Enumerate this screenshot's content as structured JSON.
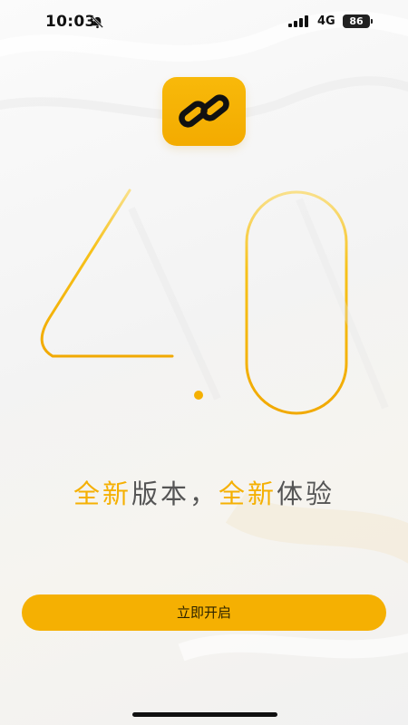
{
  "status_bar": {
    "time": "10:03",
    "network": "4G",
    "battery": "86",
    "icons": [
      "bell-off-icon",
      "signal-icon",
      "battery-icon"
    ]
  },
  "app": {
    "logo_icon": "chain-link-icon",
    "accent_color": "#F5B002"
  },
  "hero": {
    "version": "4.0"
  },
  "slogan": {
    "part1_accent": "全新",
    "part1_rest": "版本，",
    "part2_accent": "全新",
    "part2_rest": "体验"
  },
  "actions": {
    "start_label": "立即开启"
  }
}
